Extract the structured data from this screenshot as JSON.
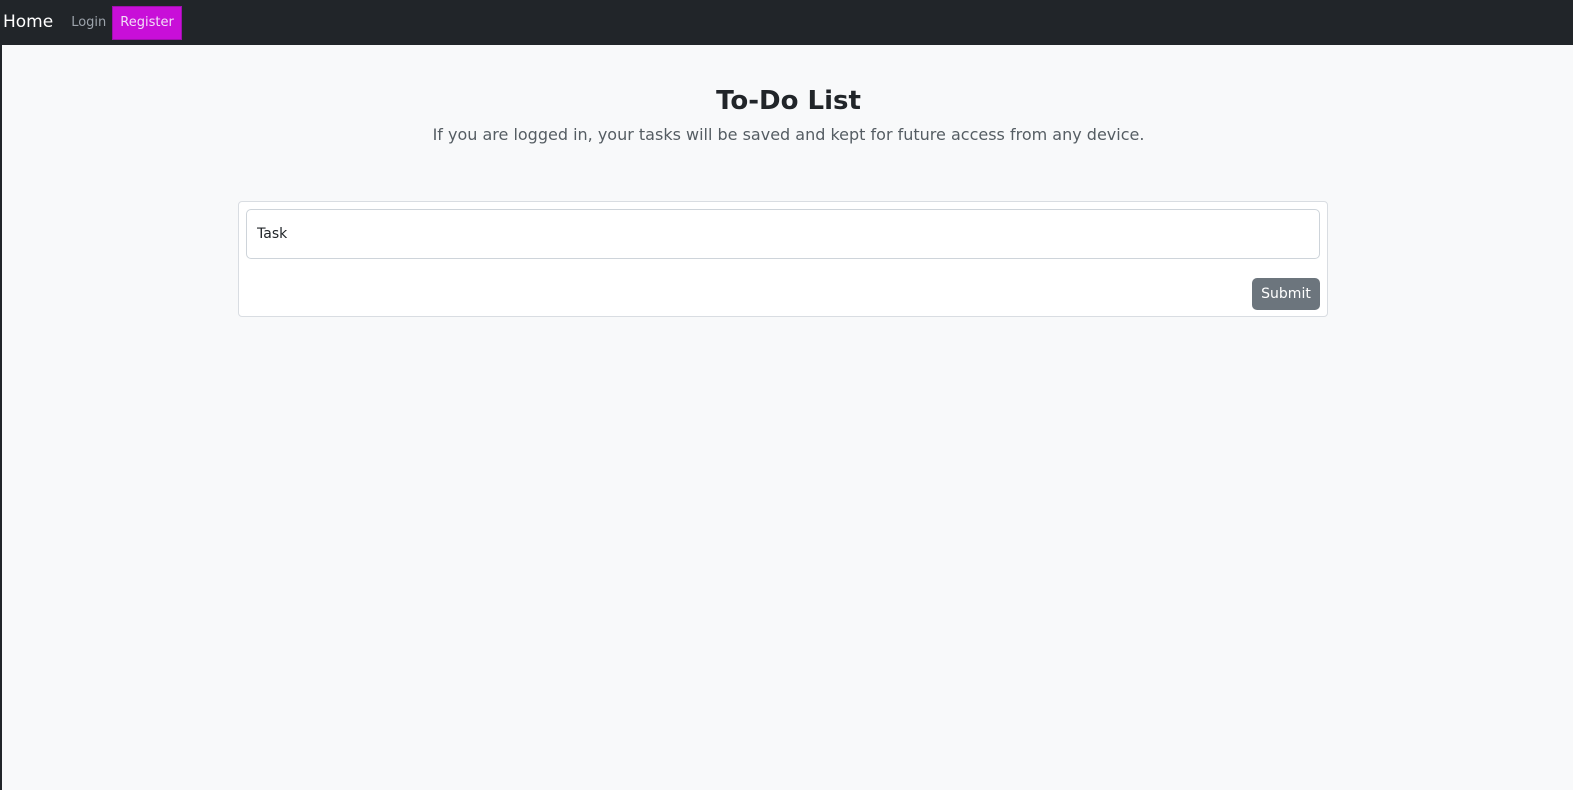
{
  "nav": {
    "home_label": "Home",
    "login_label": "Login",
    "register_label": "Register"
  },
  "header": {
    "title": "To-Do List",
    "subtitle": "If you are logged in, your tasks will be saved and kept for future access from any device."
  },
  "form": {
    "task_value": "",
    "task_placeholder": "Task",
    "submit_label": "Submit"
  },
  "colors": {
    "navbar_bg": "#212529",
    "register_accent": "#c80fd8",
    "submit_bg": "#6c757d",
    "page_bg": "#f8f9fa"
  }
}
